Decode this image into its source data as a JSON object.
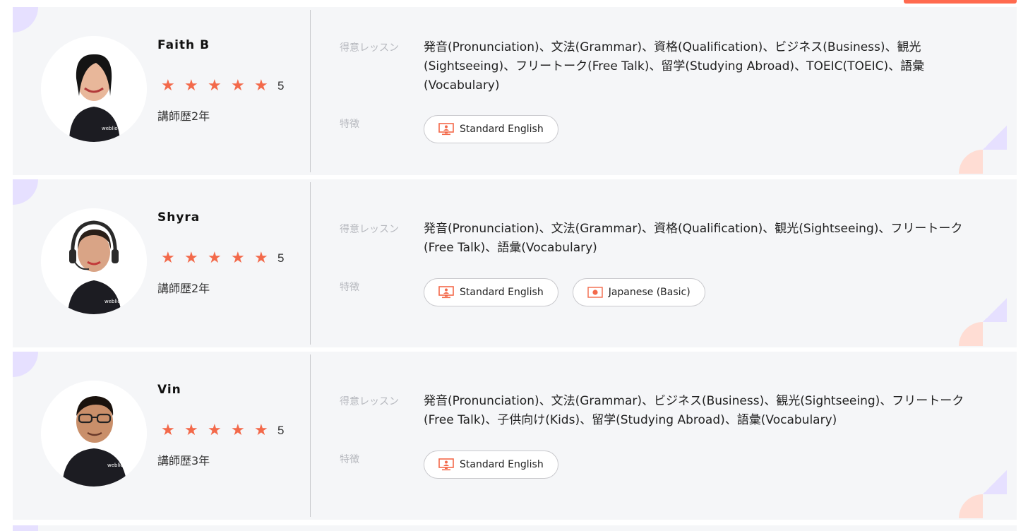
{
  "labels": {
    "lessons": "得意レッスン",
    "features": "特徴"
  },
  "teachers": [
    {
      "name": "Faith B",
      "rating": "5",
      "experience": "講師歴2年",
      "lessons": "発音(Pronunciation)、文法(Grammar)、資格(Qualification)、ビジネス(Business)、観光(Sightseeing)、フリートーク(Free Talk)、留学(Studying Abroad)、TOEIC(TOEIC)、語彙(Vocabulary)",
      "tags": [
        {
          "label": "Standard English",
          "icon": "teacher-screen-icon"
        }
      ]
    },
    {
      "name": "Shyra",
      "rating": "5",
      "experience": "講師歴2年",
      "lessons": "発音(Pronunciation)、文法(Grammar)、資格(Qualification)、観光(Sightseeing)、フリートーク(Free Talk)、語彙(Vocabulary)",
      "tags": [
        {
          "label": "Standard English",
          "icon": "teacher-screen-icon"
        },
        {
          "label": "Japanese (Basic)",
          "icon": "japan-flag-icon"
        }
      ]
    },
    {
      "name": "Vin",
      "rating": "5",
      "experience": "講師歴3年",
      "lessons": "発音(Pronunciation)、文法(Grammar)、ビジネス(Business)、観光(Sightseeing)、フリートーク(Free Talk)、子供向け(Kids)、留学(Studying Abroad)、語彙(Vocabulary)",
      "tags": [
        {
          "label": "Standard English",
          "icon": "teacher-screen-icon"
        }
      ]
    }
  ],
  "colors": {
    "accent": "#f3694a",
    "card_bg": "#f5f6f8",
    "deco_purple": "#e6e0ff",
    "deco_peach": "#ffddd4"
  }
}
